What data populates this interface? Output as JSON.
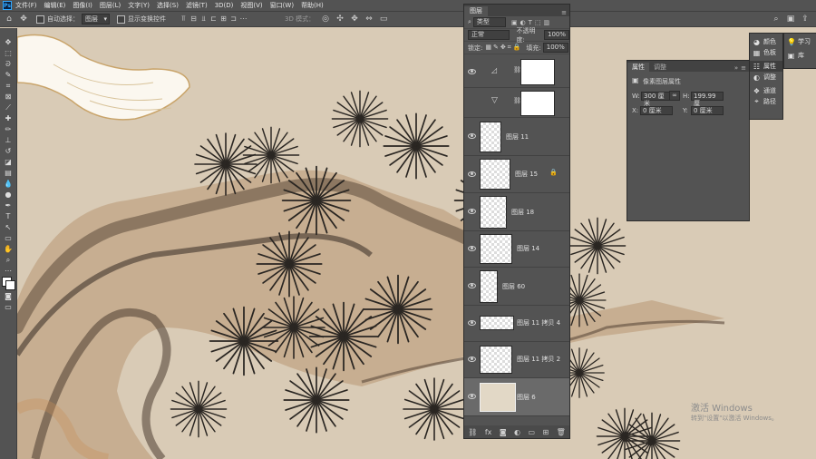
{
  "menubar": {
    "logo": "Ps",
    "items": [
      "文件(F)",
      "编辑(E)",
      "图像(I)",
      "图层(L)",
      "文字(Y)",
      "选择(S)",
      "滤镜(T)",
      "3D(D)",
      "视图(V)",
      "窗口(W)",
      "帮助(H)"
    ]
  },
  "options": {
    "auto_select_label": "自动选择：",
    "auto_select_target": "图层",
    "show_transform_label": "显示变换控件",
    "mode_3d": "3D 模式："
  },
  "layers_panel": {
    "tab_label": "图层",
    "filter_label": "类型",
    "blend_mode": "正常",
    "opacity_label": "不透明度:",
    "opacity_value": "100%",
    "lock_label": "锁定:",
    "fill_label": "填充:",
    "fill_value": "100%",
    "layers": [
      {
        "name": "",
        "kind": "adjustment-levels"
      },
      {
        "name": "",
        "kind": "adjustment-triangle"
      },
      {
        "name": "图层 11"
      },
      {
        "name": "图层 15",
        "locked": true
      },
      {
        "name": "图层 18"
      },
      {
        "name": "图层 14"
      },
      {
        "name": "图层 60"
      },
      {
        "name": "图层 11 拷贝 4"
      },
      {
        "name": "图层 11 拷贝 2"
      },
      {
        "name": "图层 6",
        "selected": true
      }
    ]
  },
  "properties_panel": {
    "tab_properties": "属性",
    "tab_adjustments": "调整",
    "section_title": "像素图层属性",
    "w_label": "W:",
    "w_value": "300 厘米",
    "h_label": "H:",
    "h_value": "199.99 厘",
    "x_label": "X:",
    "x_value": "0 厘米",
    "y_label": "Y:",
    "y_value": "0 厘米"
  },
  "dock": {
    "items": [
      "颜色",
      "色板",
      "属性",
      "调整",
      "通道",
      "路径"
    ],
    "items2": [
      "学习",
      "库"
    ]
  },
  "watermark": {
    "title": "激活 Windows",
    "subtitle": "转到\"设置\"以激活 Windows。"
  }
}
